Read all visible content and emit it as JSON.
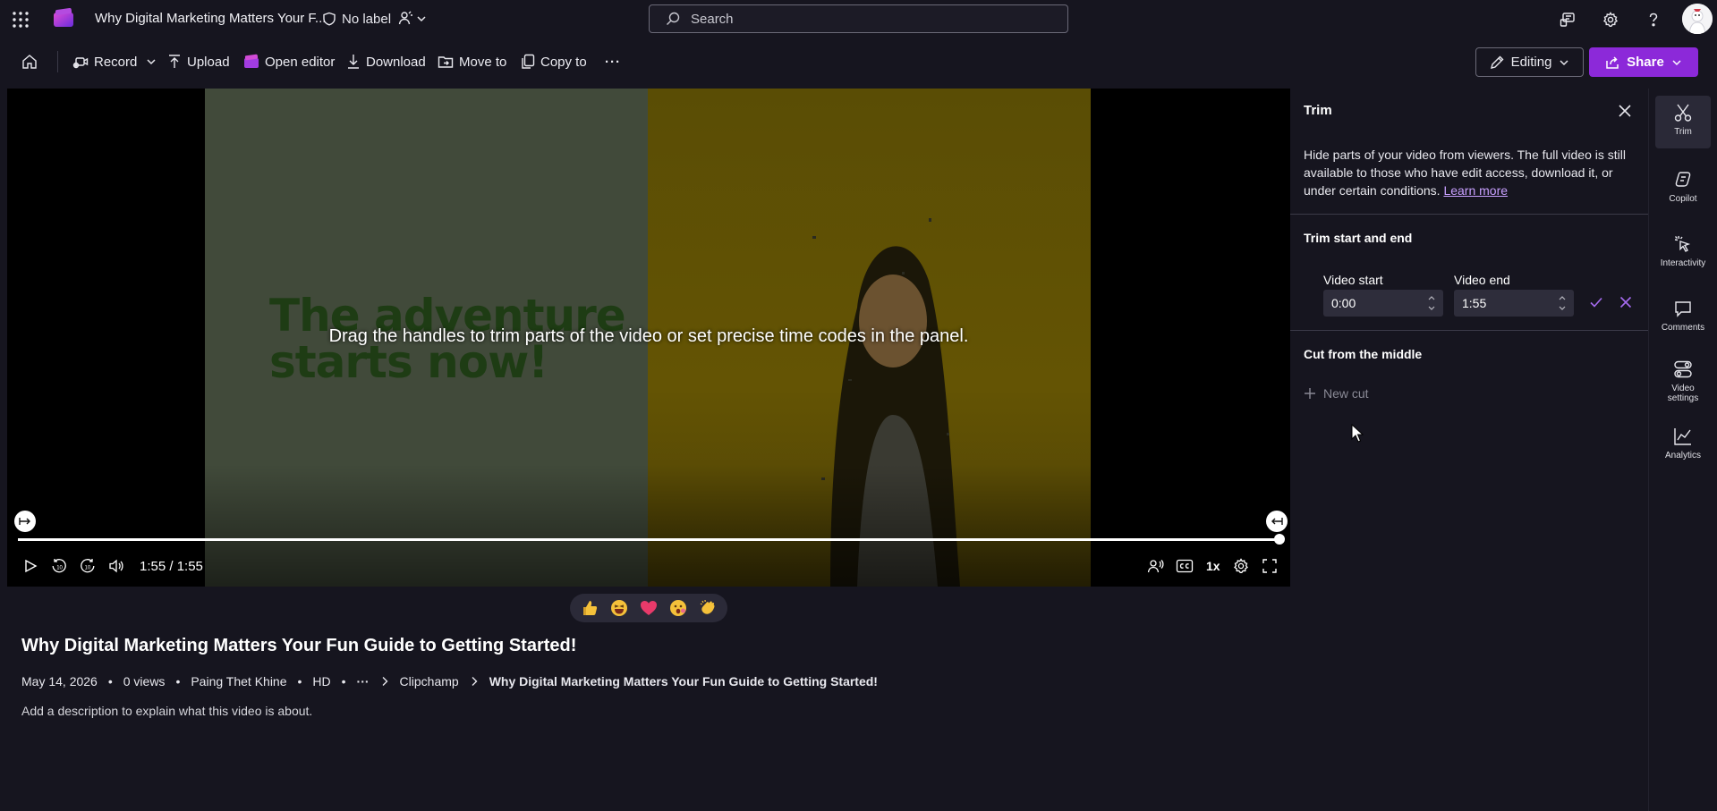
{
  "header": {
    "title": "Why Digital Marketing Matters Your F...",
    "sensitivity_label": "No label",
    "search_placeholder": "Search",
    "icons": [
      "app-launcher-icon",
      "stream-logo-icon",
      "shield-icon",
      "people-icon",
      "feedback-icon",
      "gear-icon",
      "help-icon",
      "avatar"
    ]
  },
  "toolbar": {
    "record": "Record",
    "upload": "Upload",
    "open_editor": "Open editor",
    "download": "Download",
    "move_to": "Move to",
    "copy_to": "Copy to",
    "more": "···",
    "editing": "Editing",
    "share": "Share"
  },
  "player": {
    "slide_line1": "The adventure",
    "slide_line2": "starts now!",
    "overlay_message": "Drag the handles to trim parts of the video or set precise time codes in the panel.",
    "time": "1:55 / 1:55",
    "speed": "1x",
    "progress_fraction": 1.0,
    "skip_seconds": "10"
  },
  "reactions": [
    "like",
    "laugh",
    "heart",
    "surprised",
    "applause"
  ],
  "video_info": {
    "title": "Why Digital Marketing Matters Your Fun Guide to Getting Started!",
    "date": "May 14, 2026",
    "views": "0 views",
    "owner": "Paing Thet Khine",
    "quality": "HD",
    "more": "···",
    "breadcrumb_folder": "Clipchamp",
    "breadcrumb_current": "Why Digital Marketing Matters Your Fun Guide to Getting Started!",
    "description_placeholder": "Add a description to explain what this video is about."
  },
  "trim_panel": {
    "title": "Trim",
    "description": "Hide parts of your video from viewers. The full video is still available to those who have edit access, download it, or under certain conditions.",
    "learn_more": "Learn more",
    "section_trim": "Trim start and end",
    "video_start_label": "Video start",
    "video_start_value": "0:00",
    "video_end_label": "Video end",
    "video_end_value": "1:55",
    "section_cut": "Cut from the middle",
    "new_cut": "New cut"
  },
  "rail": {
    "trim": "Trim",
    "copilot": "Copilot",
    "interactivity": "Interactivity",
    "comments": "Comments",
    "video_settings": "Video settings",
    "analytics": "Analytics"
  },
  "colors": {
    "background": "#16151f",
    "accent": "#8c29d9",
    "link": "#c8a0ff"
  }
}
